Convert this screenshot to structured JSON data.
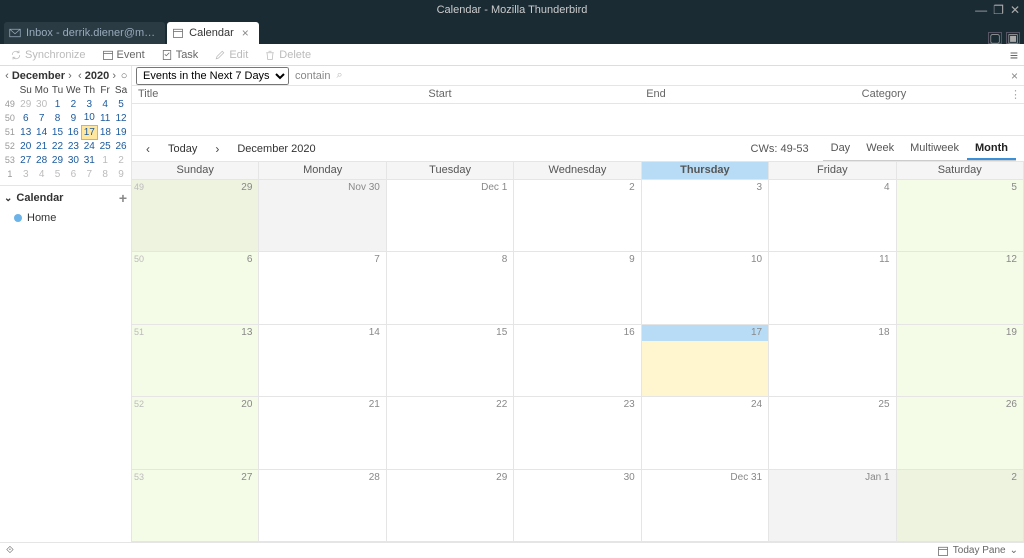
{
  "window": {
    "title": "Calendar - Mozilla Thunderbird"
  },
  "tabs": {
    "inactive_label": "Inbox - derrik.diener@m…",
    "active_label": "Calendar"
  },
  "toolbar": {
    "sync": "Synchronize",
    "event": "Event",
    "task": "Task",
    "edit": "Edit",
    "delete": "Delete"
  },
  "mini": {
    "month_label": "December",
    "year_label": "2020",
    "dow": [
      "Su",
      "Mo",
      "Tu",
      "We",
      "Th",
      "Fr",
      "Sa"
    ],
    "rows": [
      {
        "wk": "49",
        "days": [
          {
            "d": "29",
            "off": true
          },
          {
            "d": "30",
            "off": true
          },
          {
            "d": "1"
          },
          {
            "d": "2"
          },
          {
            "d": "3"
          },
          {
            "d": "4"
          },
          {
            "d": "5"
          }
        ]
      },
      {
        "wk": "50",
        "days": [
          {
            "d": "6"
          },
          {
            "d": "7"
          },
          {
            "d": "8"
          },
          {
            "d": "9"
          },
          {
            "d": "10"
          },
          {
            "d": "11"
          },
          {
            "d": "12"
          }
        ]
      },
      {
        "wk": "51",
        "days": [
          {
            "d": "13"
          },
          {
            "d": "14"
          },
          {
            "d": "15"
          },
          {
            "d": "16"
          },
          {
            "d": "17",
            "today": true
          },
          {
            "d": "18"
          },
          {
            "d": "19"
          }
        ]
      },
      {
        "wk": "52",
        "days": [
          {
            "d": "20"
          },
          {
            "d": "21"
          },
          {
            "d": "22"
          },
          {
            "d": "23"
          },
          {
            "d": "24"
          },
          {
            "d": "25"
          },
          {
            "d": "26"
          }
        ]
      },
      {
        "wk": "53",
        "days": [
          {
            "d": "27"
          },
          {
            "d": "28"
          },
          {
            "d": "29"
          },
          {
            "d": "30"
          },
          {
            "d": "31"
          },
          {
            "d": "1",
            "off": true
          },
          {
            "d": "2",
            "off": true
          }
        ]
      },
      {
        "wk": "1",
        "days": [
          {
            "d": "3",
            "off": true
          },
          {
            "d": "4",
            "off": true
          },
          {
            "d": "5",
            "off": true
          },
          {
            "d": "6",
            "off": true
          },
          {
            "d": "7",
            "off": true
          },
          {
            "d": "8",
            "off": true
          },
          {
            "d": "9",
            "off": true
          }
        ]
      }
    ]
  },
  "sidebar": {
    "header": "Calendar",
    "items": [
      {
        "label": "Home"
      }
    ]
  },
  "filter": {
    "range_label": "Events in the Next 7 Days",
    "contain_label": "contain",
    "search_placeholder": ""
  },
  "columns": {
    "title": "Title",
    "start": "Start",
    "end": "End",
    "category": "Category"
  },
  "nav": {
    "today_label": "Today",
    "period_label": "December 2020",
    "cw_label": "CWs: 49-53",
    "views": {
      "day": "Day",
      "week": "Week",
      "multiweek": "Multiweek",
      "month": "Month"
    }
  },
  "dow_full": [
    "Sunday",
    "Monday",
    "Tuesday",
    "Wednesday",
    "Thursday",
    "Friday",
    "Saturday"
  ],
  "weeks": [
    {
      "wk": "49",
      "days": [
        {
          "label": "29",
          "off": true,
          "weekend": true
        },
        {
          "label": "Nov 30",
          "off": true
        },
        {
          "label": "Dec 1"
        },
        {
          "label": "2"
        },
        {
          "label": "3"
        },
        {
          "label": "4"
        },
        {
          "label": "5",
          "weekend": true
        }
      ]
    },
    {
      "wk": "50",
      "days": [
        {
          "label": "6",
          "weekend": true
        },
        {
          "label": "7"
        },
        {
          "label": "8"
        },
        {
          "label": "9"
        },
        {
          "label": "10"
        },
        {
          "label": "11"
        },
        {
          "label": "12",
          "weekend": true
        }
      ]
    },
    {
      "wk": "51",
      "days": [
        {
          "label": "13",
          "weekend": true
        },
        {
          "label": "14"
        },
        {
          "label": "15"
        },
        {
          "label": "16"
        },
        {
          "label": "17",
          "today": true
        },
        {
          "label": "18"
        },
        {
          "label": "19",
          "weekend": true
        }
      ]
    },
    {
      "wk": "52",
      "days": [
        {
          "label": "20",
          "weekend": true
        },
        {
          "label": "21"
        },
        {
          "label": "22"
        },
        {
          "label": "23"
        },
        {
          "label": "24"
        },
        {
          "label": "25"
        },
        {
          "label": "26",
          "weekend": true
        }
      ]
    },
    {
      "wk": "53",
      "days": [
        {
          "label": "27",
          "weekend": true
        },
        {
          "label": "28"
        },
        {
          "label": "29"
        },
        {
          "label": "30"
        },
        {
          "label": "Dec 31"
        },
        {
          "label": "Jan 1",
          "off": true
        },
        {
          "label": "2",
          "off": true,
          "weekend": true
        }
      ]
    }
  ],
  "status": {
    "today_pane": "Today Pane"
  }
}
